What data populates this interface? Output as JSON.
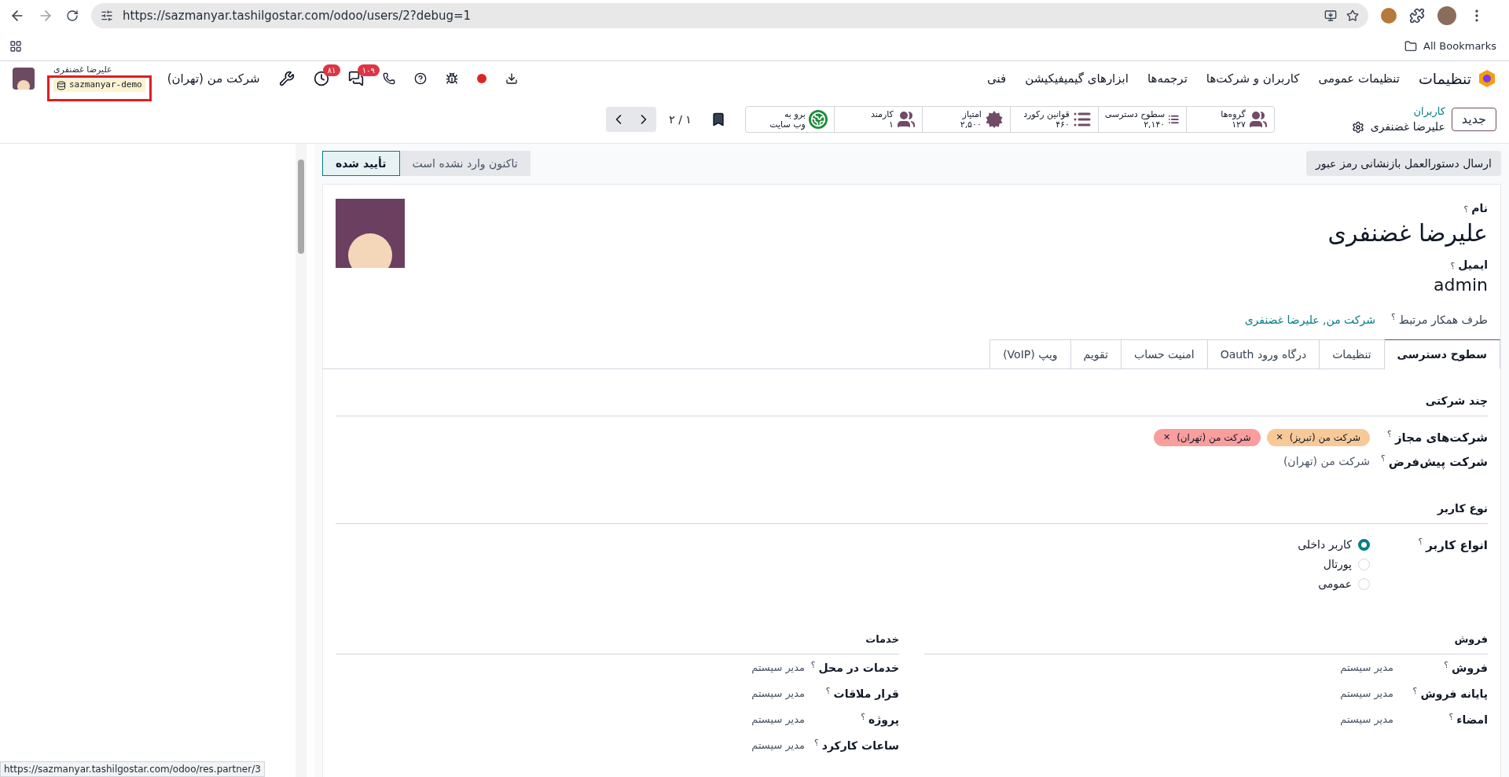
{
  "browser": {
    "url": "https://sazmanyar.tashilgostar.com/odoo/users/2?debug=1",
    "bookmarks": "All Bookmarks",
    "status_url": "https://sazmanyar.tashilgostar.com/odoo/res.partner/3"
  },
  "navbar": {
    "app_name": "تنظیمات",
    "menus": [
      "تنظیمات عمومی",
      "کاربران و شرکت‌ها",
      "ترجمه‌ها",
      "ابزارهای گیمیفیکیشن",
      "فنی"
    ],
    "company": "شرکت من (تهران)",
    "user_name": "علیرضا غضنفری",
    "database": "sazmanyar-demo",
    "activity_count": "۸۱",
    "message_count": "۱۰۹"
  },
  "control_panel": {
    "new_button": "جدید",
    "breadcrumb_parent": "کاربران",
    "breadcrumb_current": "علیرضا غضنفری",
    "pager": "۱ / ۲",
    "smart_buttons": [
      {
        "kind": "users",
        "label": "گروه‌ها",
        "value": "۱۲۷"
      },
      {
        "kind": "list",
        "label": "سطوح دسترسی",
        "value": "۲,۱۴۰"
      },
      {
        "kind": "list",
        "label": "قوانین رکورد",
        "value": "۴۶۰"
      },
      {
        "kind": "badge",
        "label": "امتیاز",
        "value": "۲,۵۰۰"
      },
      {
        "kind": "users",
        "label": "کارمند",
        "value": "۱"
      },
      {
        "kind": "globe",
        "label": "برو به",
        "value": "وب سایت"
      }
    ]
  },
  "form": {
    "reset_button": "ارسال دستورالعمل بازنشانی رمز عبور",
    "statuses": [
      {
        "label": "تاکنون وارد نشده است",
        "selected": false
      },
      {
        "label": "تأیید شده",
        "selected": true
      }
    ],
    "name_label": "نام",
    "name_help": "؟",
    "name": "علیرضا غضنفری",
    "email_label": "ایمیل",
    "email_help": "؟",
    "email": "admin",
    "partner_label": "طرف همکار مرتبط",
    "partner_help": "؟",
    "partner": "شرکت من, علیرضا غضنفری",
    "tabs": [
      {
        "label": "سطوح دسترسی",
        "selected": true
      },
      {
        "label": "تنظیمات",
        "selected": false
      },
      {
        "label": "درگاه ورود Oauth",
        "selected": false
      },
      {
        "label": "امنیت حساب",
        "selected": false
      },
      {
        "label": "تقویم",
        "selected": false
      },
      {
        "label": "ویپ (VoIP)",
        "selected": false
      }
    ],
    "multi_company": {
      "title": "چند شرکتی",
      "allowed_label": "شرکت‌های مجاز",
      "allowed_help": "؟",
      "allowed_tags": [
        {
          "label": "شرکت من (تبریز)",
          "color": "#f7c998",
          "remove": "✕"
        },
        {
          "label": "شرکت من (تهران)",
          "color": "#f99d9d",
          "remove": "✕"
        }
      ],
      "default_label": "شرکت پیش‌فرض",
      "default_help": "؟",
      "default_value": "شرکت من (تهران)"
    },
    "user_type": {
      "title": "نوع کاربر",
      "label": "انواع کاربر",
      "help": "؟",
      "options": [
        {
          "label": "کاربر داخلی",
          "selected": true
        },
        {
          "label": "پورتال",
          "selected": false
        },
        {
          "label": "عمومی",
          "selected": false
        }
      ]
    },
    "columns": [
      {
        "title": "فروش",
        "rows": [
          {
            "label": "فروش",
            "help": "؟",
            "value": "مدیر سیستم"
          },
          {
            "label": "پایانه فروش",
            "help": "؟",
            "value": "مدیر سیستم"
          },
          {
            "label": "امضاء",
            "help": "؟",
            "value": "مدیر سیستم"
          }
        ]
      },
      {
        "title": "خدمات",
        "rows": [
          {
            "label": "خدمات در محل",
            "help": "؟",
            "value": "مدیر سیستم"
          },
          {
            "label": "قرار ملاقات",
            "help": "؟",
            "value": "مدیر سیستم"
          },
          {
            "label": "پروژه",
            "help": "؟",
            "value": "مدیر سیستم"
          },
          {
            "label": "ساعات کارکرد",
            "help": "؟",
            "value": "مدیر سیستم"
          }
        ]
      }
    ]
  }
}
